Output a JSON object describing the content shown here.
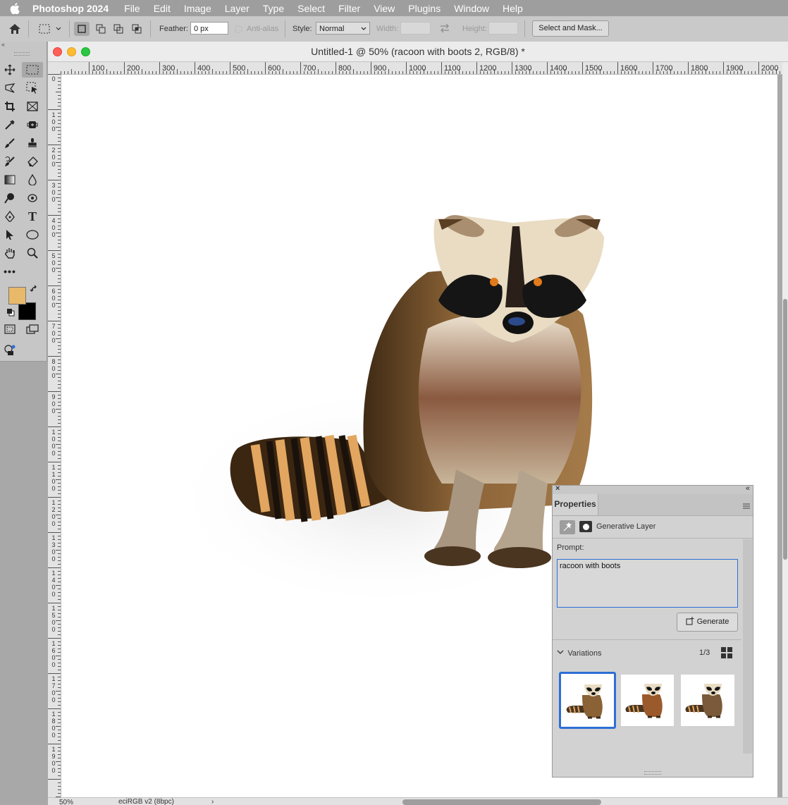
{
  "menubar": {
    "app_name": "Photoshop 2024",
    "items": [
      "File",
      "Edit",
      "Image",
      "Layer",
      "Type",
      "Select",
      "Filter",
      "View",
      "Plugins",
      "Window",
      "Help"
    ]
  },
  "options": {
    "feather_label": "Feather:",
    "feather_value": "0 px",
    "antialias_label": "Anti-alias",
    "style_label": "Style:",
    "style_value": "Normal",
    "width_label": "Width:",
    "height_label": "Height:",
    "select_mask_label": "Select and Mask..."
  },
  "toolbox": {
    "foreground_color": "#e8b96a",
    "background_color": "#000000"
  },
  "document": {
    "title": "Untitled-1 @ 50% (racoon with boots 2, RGB/8) *",
    "ruler_h": [
      "100",
      "200",
      "300",
      "400",
      "500",
      "600",
      "700",
      "800",
      "900",
      "1000",
      "1100",
      "1200",
      "1300",
      "1400",
      "1500",
      "1600",
      "1700",
      "1800",
      "1900",
      "2000"
    ],
    "ruler_v": [
      "0",
      "1\n0\n0",
      "2\n0\n0",
      "3\n0\n0",
      "4\n0\n0",
      "5\n0\n0",
      "6\n0\n0",
      "7\n0\n0",
      "8\n0\n0",
      "9\n0\n0",
      "1\n0\n0\n0",
      "1\n1\n0\n0",
      "1\n2\n0\n0",
      "1\n3\n0\n0",
      "1\n4\n0\n0",
      "1\n5\n0\n0",
      "1\n6\n0\n0",
      "1\n7\n0\n0",
      "1\n8\n0\n0",
      "1\n9\n0\n0"
    ],
    "zoom": "50%",
    "profile": "eciRGB v2 (8bpc)"
  },
  "properties": {
    "tab_label": "Properties",
    "layer_type": "Generative Layer",
    "prompt_label": "Prompt:",
    "prompt_value": "racoon with boots",
    "generate_label": "Generate",
    "variations_label": "Variations",
    "variation_count": "1/3"
  },
  "colors": {
    "accent": "#2d6fd6",
    "menubar": "#9e9e9e"
  }
}
